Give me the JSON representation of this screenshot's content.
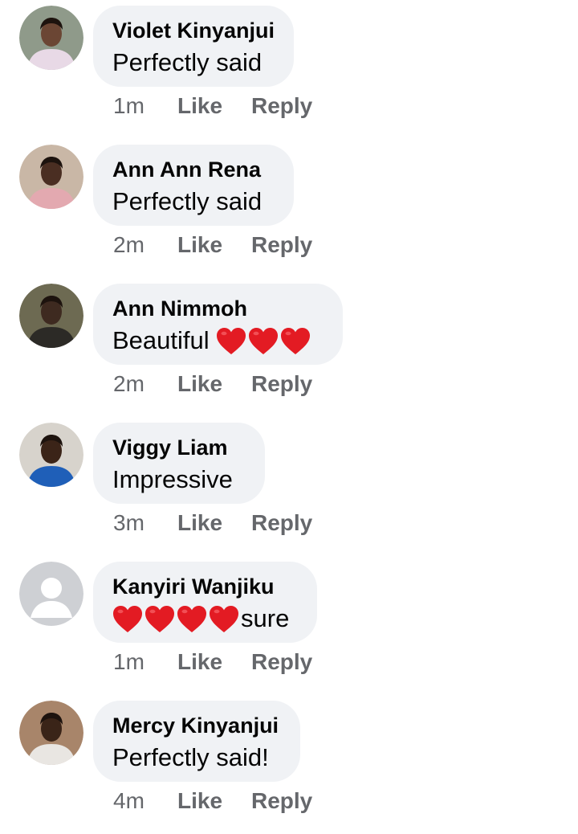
{
  "comments": [
    {
      "author": "Violet Kinyanjui",
      "text": "Perfectly said",
      "hearts": 0,
      "suffix": "",
      "time": "1m",
      "like_label": "Like",
      "reply_label": "Reply",
      "avatar_bg": "#8f9a8a",
      "avatar_skin": "#6b4634",
      "avatar_cloth": "#e8d9e6"
    },
    {
      "author": "Ann Ann Rena",
      "text": "Perfectly said",
      "hearts": 0,
      "suffix": "",
      "time": "2m",
      "like_label": "Like",
      "reply_label": "Reply",
      "avatar_bg": "#c9b7a6",
      "avatar_skin": "#4a2e22",
      "avatar_cloth": "#e3a9b0"
    },
    {
      "author": "Ann Nimmoh",
      "text": "Beautiful ",
      "hearts": 3,
      "suffix": "",
      "time": "2m",
      "like_label": "Like",
      "reply_label": "Reply",
      "avatar_bg": "#6d6a52",
      "avatar_skin": "#3e2a20",
      "avatar_cloth": "#2c2a26"
    },
    {
      "author": "Viggy Liam",
      "text": "Impressive",
      "hearts": 0,
      "suffix": "",
      "time": "3m",
      "like_label": "Like",
      "reply_label": "Reply",
      "avatar_bg": "#d7d3cc",
      "avatar_skin": "#3b2418",
      "avatar_cloth": "#1f5fb8"
    },
    {
      "author": "Kanyiri Wanjiku",
      "text": "",
      "hearts": 4,
      "suffix": "sure",
      "time": "1m",
      "like_label": "Like",
      "reply_label": "Reply",
      "avatar_bg": "#ced0d4",
      "avatar_skin": "#ffffff",
      "avatar_cloth": "#ffffff"
    },
    {
      "author": "Mercy Kinyanjui",
      "text": "Perfectly said!",
      "hearts": 0,
      "suffix": "",
      "time": "4m",
      "like_label": "Like",
      "reply_label": "Reply",
      "avatar_bg": "#a8856a",
      "avatar_skin": "#3a2418",
      "avatar_cloth": "#e9e6e2"
    }
  ],
  "colors": {
    "bubble_bg": "#f0f2f5",
    "text": "#050505",
    "meta": "#65676b",
    "heart": "#e31b23"
  },
  "icons": {
    "heart": "red-heart-icon",
    "avatar": "profile-photo",
    "default_avatar": "default-avatar-icon"
  }
}
